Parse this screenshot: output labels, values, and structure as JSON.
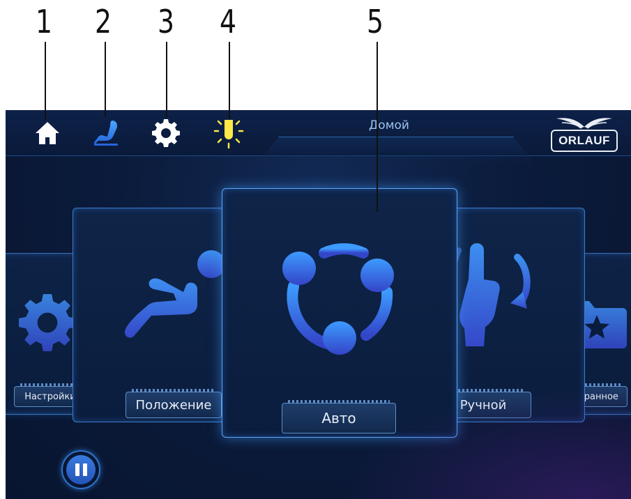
{
  "callouts": [
    "1",
    "2",
    "3",
    "4",
    "5"
  ],
  "topbar": {
    "title": "Домой",
    "icons": {
      "home": "home-icon",
      "massage_chair": "massage-chair-icon",
      "settings": "gear-icon",
      "light": "light-bulb-icon"
    },
    "logo_text": "ORLAUF"
  },
  "carousel": {
    "cards": [
      {
        "label": "Настройки",
        "icon": "gear-icon"
      },
      {
        "label": "Положение",
        "icon": "reclining-person-icon"
      },
      {
        "label": "Авто",
        "icon": "auto-cycle-icon",
        "selected": true
      },
      {
        "label": "Ручной",
        "icon": "manual-hand-icon"
      },
      {
        "label": "Избранное",
        "icon": "favorites-folder-icon"
      }
    ]
  },
  "controls": {
    "pause_icon": "pause-icon"
  },
  "colors": {
    "accent_blue": "#3aa2ff",
    "home_icon": "#ffffff",
    "chair_icon": "#2f8ff0",
    "light_icon": "#ffe94a",
    "icon_gradient_top": "#3d8ff0",
    "icon_gradient_bottom": "#3548c8"
  }
}
